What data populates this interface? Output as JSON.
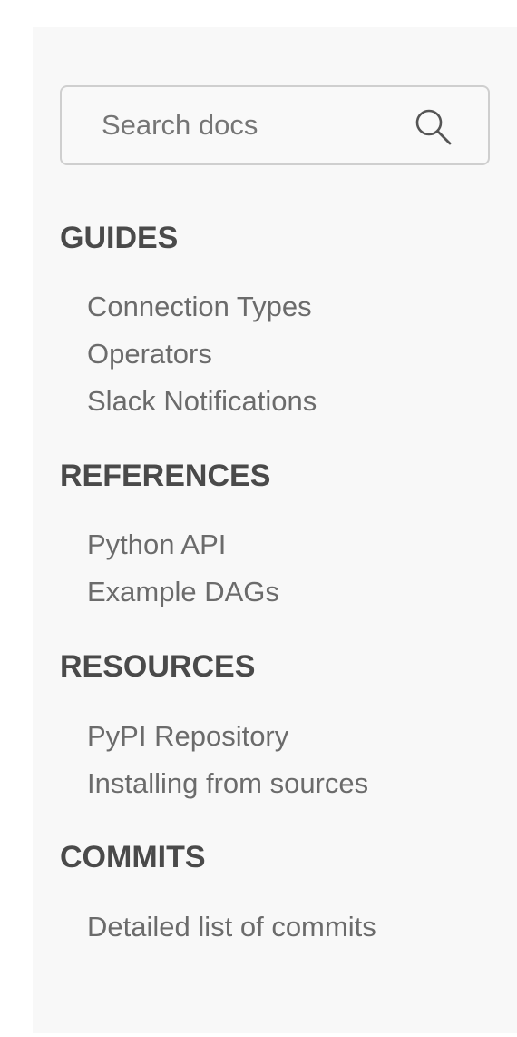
{
  "search": {
    "placeholder": "Search docs",
    "icon": "search-icon"
  },
  "sections": {
    "guides": {
      "title": "GUIDES",
      "items": [
        "Connection Types",
        "Operators",
        "Slack Notifications"
      ]
    },
    "references": {
      "title": "REFERENCES",
      "items": [
        "Python API",
        "Example DAGs"
      ]
    },
    "resources": {
      "title": "RESOURCES",
      "items": [
        "PyPI Repository",
        "Installing from sources"
      ]
    },
    "commits": {
      "title": "COMMITS",
      "items": [
        "Detailed list of commits"
      ]
    }
  },
  "colors": {
    "sidebar_background": "#f8f8f8",
    "heading_text": "#4a4a4a",
    "link_text": "#6b6b6b",
    "search_border": "#cfcfcf"
  }
}
